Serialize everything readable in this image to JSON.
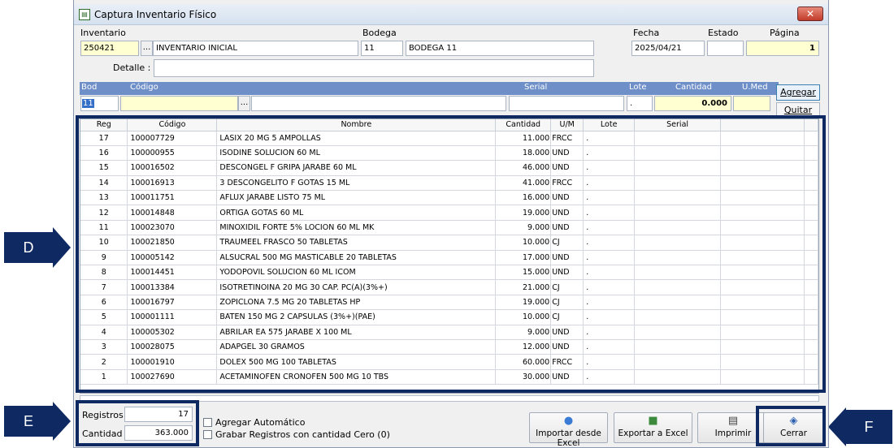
{
  "window": {
    "title": "Captura Inventario Físico",
    "close_glyph": "✕"
  },
  "header": {
    "inventario_label": "Inventario",
    "inventario_code": "250421",
    "inventario_name": "INVENTARIO INICIAL",
    "bodega_label": "Bodega",
    "bodega_code": "11",
    "bodega_name": "BODEGA 11",
    "fecha_label": "Fecha",
    "fecha_value": "2025/04/21",
    "estado_label": "Estado",
    "estado_value": "",
    "pagina_label": "Página",
    "pagina_value": "1",
    "detalle_label": "Detalle :",
    "detalle_value": "",
    "dots": "..."
  },
  "entry": {
    "bod_label": "Bod",
    "codigo_label": "Código",
    "serial_label": "Serial",
    "lote_label": "Lote",
    "cantidad_label": "Cantidad",
    "umed_label": "U.Med",
    "bod_value": "11",
    "lote_value": ".",
    "cantidad_value": "0.000",
    "agregar_label": "Agregar",
    "quitar_label": "Quitar"
  },
  "table": {
    "columns": [
      "Reg",
      "Código",
      "Nombre",
      "Cantidad",
      "U/M",
      "Lote",
      "Serial"
    ],
    "rows": [
      {
        "reg": "17",
        "codigo": "100007729",
        "nombre": "LASIX 20 MG 5 AMPOLLAS",
        "cantidad": "11.000",
        "um": "FRCC",
        "lote": ".",
        "serial": ""
      },
      {
        "reg": "16",
        "codigo": "100000955",
        "nombre": "ISODINE SOLUCION 60 ML",
        "cantidad": "18.000",
        "um": "UND",
        "lote": ".",
        "serial": ""
      },
      {
        "reg": "15",
        "codigo": "100016502",
        "nombre": "DESCONGEL F GRIPA JARABE 60 ML",
        "cantidad": "46.000",
        "um": "UND",
        "lote": ".",
        "serial": ""
      },
      {
        "reg": "14",
        "codigo": "100016913",
        "nombre": "3 DESCONGELITO F GOTAS 15 ML",
        "cantidad": "41.000",
        "um": "FRCC",
        "lote": ".",
        "serial": ""
      },
      {
        "reg": "13",
        "codigo": "100011751",
        "nombre": "AFLUX JARABE LISTO 75 ML",
        "cantidad": "16.000",
        "um": "UND",
        "lote": ".",
        "serial": ""
      },
      {
        "reg": "12",
        "codigo": "100014848",
        "nombre": "ORTIGA GOTAS 60 ML",
        "cantidad": "19.000",
        "um": "UND",
        "lote": ".",
        "serial": ""
      },
      {
        "reg": "11",
        "codigo": "100023070",
        "nombre": "MINOXIDIL FORTE 5% LOCION 60 ML MK",
        "cantidad": "9.000",
        "um": "UND",
        "lote": ".",
        "serial": ""
      },
      {
        "reg": "10",
        "codigo": "100021850",
        "nombre": "TRAUMEEL FRASCO 50 TABLETAS",
        "cantidad": "10.000",
        "um": "CJ",
        "lote": ".",
        "serial": ""
      },
      {
        "reg": "9",
        "codigo": "100005142",
        "nombre": "ALSUCRAL 500 MG MASTICABLE 20 TABLETAS",
        "cantidad": "17.000",
        "um": "UND",
        "lote": ".",
        "serial": ""
      },
      {
        "reg": "8",
        "codigo": "100014451",
        "nombre": "YODOPOVIL SOLUCION 60 ML ICOM",
        "cantidad": "15.000",
        "um": "UND",
        "lote": ".",
        "serial": ""
      },
      {
        "reg": "7",
        "codigo": "100013384",
        "nombre": "ISOTRETINOINA 20 MG 30 CAP. PC(A)(3%+)",
        "cantidad": "21.000",
        "um": "CJ",
        "lote": ".",
        "serial": ""
      },
      {
        "reg": "6",
        "codigo": "100016797",
        "nombre": "ZOPICLONA 7.5 MG 20 TABLETAS HP",
        "cantidad": "19.000",
        "um": "CJ",
        "lote": ".",
        "serial": ""
      },
      {
        "reg": "5",
        "codigo": "100001111",
        "nombre": "BATEN 150 MG 2 CAPSULAS (3%+)(PAE)",
        "cantidad": "10.000",
        "um": "CJ",
        "lote": ".",
        "serial": ""
      },
      {
        "reg": "4",
        "codigo": "100005302",
        "nombre": "ABRILAR EA 575 JARABE X 100 ML",
        "cantidad": "9.000",
        "um": "UND",
        "lote": ".",
        "serial": ""
      },
      {
        "reg": "3",
        "codigo": "100028075",
        "nombre": "ADAPGEL 30 GRAMOS",
        "cantidad": "12.000",
        "um": "UND",
        "lote": ".",
        "serial": ""
      },
      {
        "reg": "2",
        "codigo": "100001910",
        "nombre": "DOLEX 500 MG 100 TABLETAS",
        "cantidad": "60.000",
        "um": "FRCC",
        "lote": ".",
        "serial": ""
      },
      {
        "reg": "1",
        "codigo": "100027690",
        "nombre": "ACETAMINOFEN CRONOFEN 500 MG 10 TBS",
        "cantidad": "30.000",
        "um": "UND",
        "lote": ".",
        "serial": ""
      }
    ]
  },
  "footer": {
    "registros_label": "Registros :",
    "registros_value": "17",
    "cantidad_label": "Cantidad :",
    "cantidad_value": "363.000",
    "agregar_auto_label": "Agregar Automático",
    "grabar_cero_label": "Grabar Registros con cantidad Cero (0)",
    "importar_label": "Importar desde Excel",
    "exportar_label": "Exportar a Excel",
    "imprimir_label": "Imprimir",
    "cerrar_label": "Cerrar",
    "importar_icon": "people-icon",
    "exportar_icon": "briefcase-icon",
    "imprimir_icon": "printer-icon",
    "cerrar_icon": "door-icon"
  },
  "annotations": {
    "d": "D",
    "e": "E",
    "f": "F",
    "color": "#0f2a63"
  }
}
